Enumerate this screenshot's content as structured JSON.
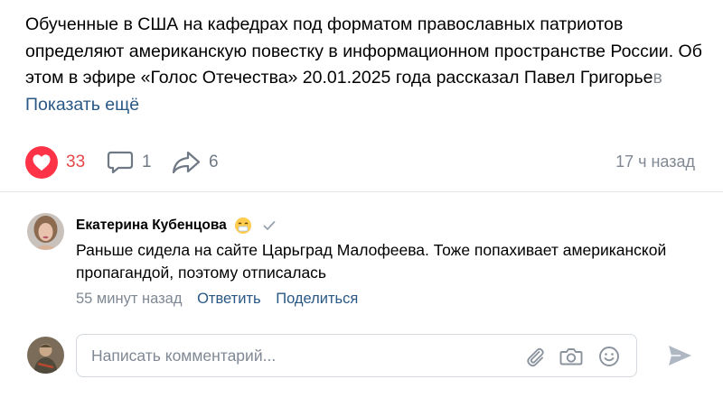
{
  "post": {
    "text_main": "Обученные в США на кафедрах под форматом православных патриотов определяют американскую повестку в информационном пространстве России. Об этом в эфире «Голос Отечества» 20.01.2025 года рассказал Павел Григорье",
    "text_fade": "в",
    "show_more": "Показать ещё",
    "likes": "33",
    "comments": "1",
    "shares": "6",
    "time_ago": "17 ч назад"
  },
  "comment": {
    "author": "Екатерина Кубенцова",
    "text": "Раньше сидела на сайте Царьград Малофеева. Тоже попахивает американской пропагандой, поэтому отписалась",
    "time": "55 минут назад",
    "reply": "Ответить",
    "share": "Поделиться"
  },
  "composer": {
    "placeholder": "Написать комментарий..."
  },
  "colors": {
    "like": "#ff3347",
    "link": "#2a5885",
    "muted": "#7f8893"
  },
  "icons": [
    "heart-icon",
    "comment-icon",
    "share-icon",
    "emoji-face-icon",
    "verified-check-icon",
    "paperclip-icon",
    "camera-icon",
    "smile-icon",
    "send-icon"
  ]
}
